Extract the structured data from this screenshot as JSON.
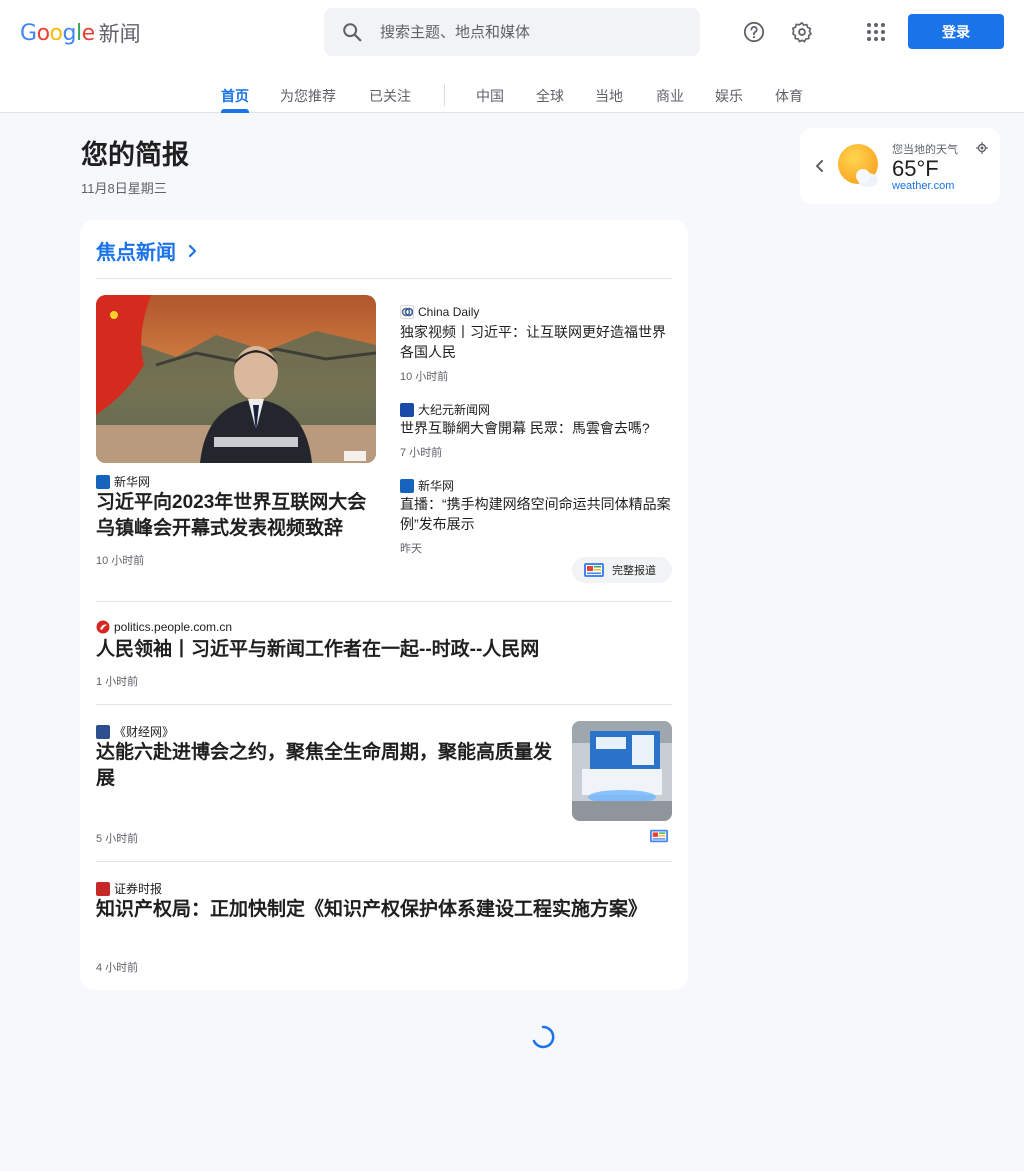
{
  "header": {
    "logo_suffix": "新闻",
    "search_placeholder": "搜索主题、地点和媒体",
    "signin_label": "登录"
  },
  "tabs": [
    {
      "label": "首页",
      "active": true
    },
    {
      "label": "为您推荐"
    },
    {
      "label": "已关注"
    },
    {
      "label": "中国"
    },
    {
      "label": "全球"
    },
    {
      "label": "当地"
    },
    {
      "label": "商业"
    },
    {
      "label": "娱乐"
    },
    {
      "label": "体育"
    }
  ],
  "briefing": {
    "title": "您的简报",
    "date": "11月8日星期三"
  },
  "weather": {
    "label": "您当地的天气",
    "temp": "65°F",
    "source": "weather.com"
  },
  "top_stories": {
    "heading": "焦点新闻",
    "main": {
      "source": "新华网",
      "headline": "习近平向2023年世界互联网大会乌镇峰会开幕式发表视频致辞",
      "time": "10 小时前"
    },
    "related": [
      {
        "source": "China Daily",
        "headline": "独家视频丨习近平：让互联网更好造福世界各国人民",
        "time": "10 小时前"
      },
      {
        "source": "大纪元新闻网",
        "headline": "世界互聯網大會開幕 民眾：馬雲會去嗎?",
        "time": "7 小时前"
      },
      {
        "source": "新华网",
        "headline": "直播：“携手构建网络空间命运共同体精品案例”发布展示",
        "time": "昨天"
      }
    ],
    "full_coverage_label": "完整报道",
    "stories": [
      {
        "source": "politics.people.com.cn",
        "headline": "人民领袖丨习近平与新闻工作者在一起--时政--人民网",
        "time": "1 小时前"
      },
      {
        "source": "《财经网》",
        "headline": "达能六赴进博会之约，聚焦全生命周期，聚能高质量发展",
        "time": "5 小时前"
      },
      {
        "source": "证券时报",
        "headline": "知识产权局：正加快制定《知识产权保护体系建设工程实施方案》",
        "time": "4 小时前"
      }
    ]
  },
  "colors": {
    "accent": "#1a73e8",
    "page_bg": "#f6f8fc",
    "card_bg": "#ffffff"
  }
}
